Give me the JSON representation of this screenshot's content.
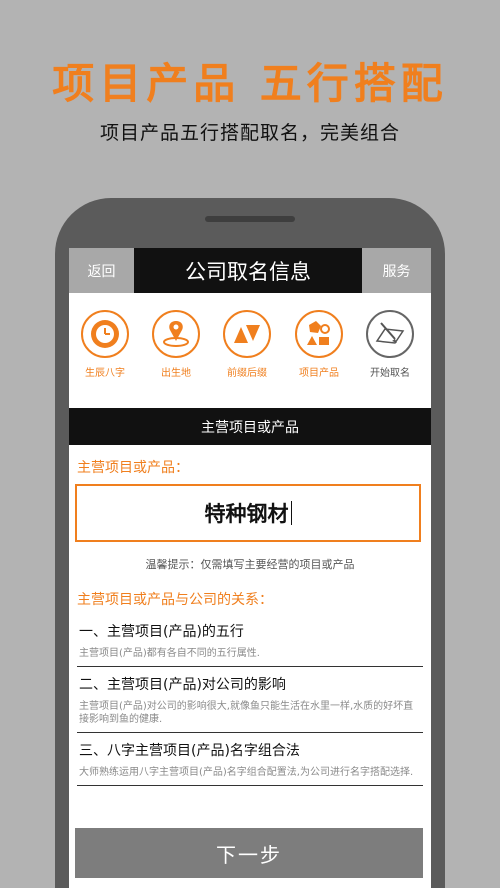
{
  "promo": {
    "title": "项目产品  五行搭配",
    "subtitle": "项目产品五行搭配取名，完美组合"
  },
  "topbar": {
    "back_label": "返回",
    "title": "公司取名信息",
    "service_label": "服务"
  },
  "steps": [
    {
      "label": "生辰八字",
      "icon": "clock-icon"
    },
    {
      "label": "出生地",
      "icon": "location-pin-icon"
    },
    {
      "label": "前缀后缀",
      "icon": "triangles-icon"
    },
    {
      "label": "项目产品",
      "icon": "shapes-icon"
    },
    {
      "label": "开始取名",
      "icon": "pen-paper-icon"
    }
  ],
  "section_bar": "主营项目或产品",
  "form": {
    "field_label": "主营项目或产品：",
    "value": "特种钢材",
    "hint": "温馨提示：仅需填写主要经营的项目或产品"
  },
  "relation": {
    "label": "主营项目或产品与公司的关系：",
    "items": [
      {
        "head": "一、主营项目(产品)的五行",
        "desc": "主营项目(产品)都有各自不同的五行属性."
      },
      {
        "head": "二、主营项目(产品)对公司的影响",
        "desc": "主营项目(产品)对公司的影响很大,就像鱼只能生活在水里一样,水质的好坏直接影响到鱼的健康."
      },
      {
        "head": "三、八字主营项目(产品)名字组合法",
        "desc": "大师熟练运用八字主营项目(产品)名字组合配置法,为公司进行名字搭配选择."
      }
    ]
  },
  "next_label": "下一步",
  "colors": {
    "accent": "#f07f1e",
    "bar": "#111111",
    "side_button": "#a8a8a8",
    "next_button": "#7d7d7d"
  }
}
